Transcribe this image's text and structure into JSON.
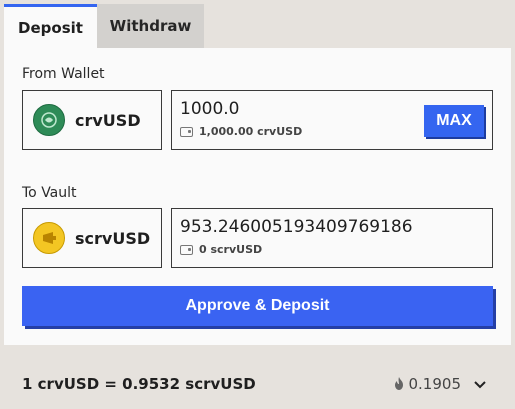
{
  "tabs": [
    {
      "label": "Deposit",
      "active": true
    },
    {
      "label": "Withdraw",
      "active": false
    }
  ],
  "from_wallet": {
    "label": "From Wallet",
    "token": "crvUSD",
    "token_icon": "crvusd-coin-icon",
    "amount": "1000.0",
    "balance": "1,000.00 crvUSD",
    "max_label": "MAX"
  },
  "to_vault": {
    "label": "To Vault",
    "token": "scrvUSD",
    "token_icon": "scrvusd-coin-icon",
    "amount": "953.246005193409769186",
    "balance": "0 scrvUSD"
  },
  "action": {
    "label": "Approve & Deposit"
  },
  "footer": {
    "rate": "1 crvUSD = 0.9532 scrvUSD",
    "apy": "0.1905"
  },
  "colors": {
    "accent": "#3465f0",
    "background": "#e6e2dd",
    "panel": "#fafafa"
  }
}
